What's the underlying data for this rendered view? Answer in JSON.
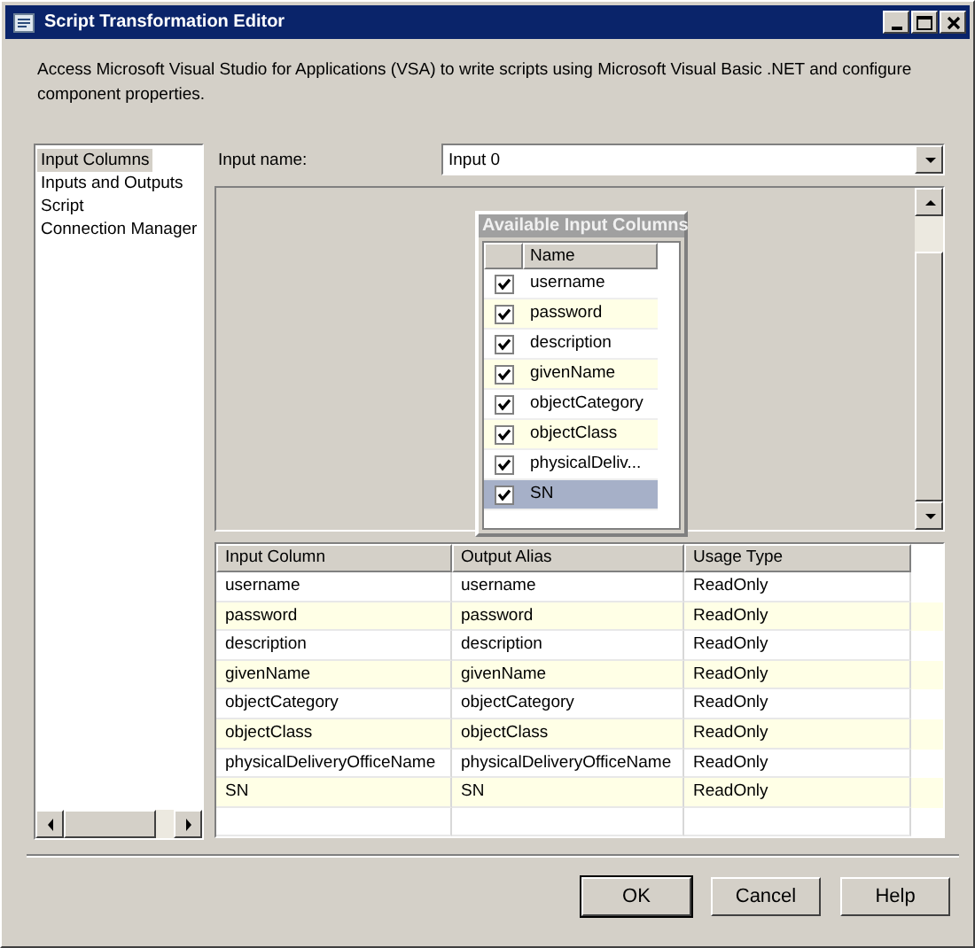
{
  "window": {
    "title": "Script Transformation Editor"
  },
  "description": "Access Microsoft Visual Studio for Applications (VSA) to write scripts using Microsoft Visual Basic .NET and configure component properties.",
  "sidebar": {
    "items": [
      {
        "label": "Input Columns",
        "selected": true
      },
      {
        "label": "Inputs and Outputs",
        "selected": false
      },
      {
        "label": "Script",
        "selected": false
      },
      {
        "label": "Connection Manager",
        "selected": false
      }
    ]
  },
  "input_name": {
    "label": "Input name:",
    "value": "Input 0"
  },
  "available_columns": {
    "title": "Available Input Columns",
    "header": "Name",
    "rows": [
      {
        "name": "username",
        "checked": true,
        "selected": false
      },
      {
        "name": "password",
        "checked": true,
        "selected": false
      },
      {
        "name": "description",
        "checked": true,
        "selected": false
      },
      {
        "name": "givenName",
        "checked": true,
        "selected": false
      },
      {
        "name": "objectCategory",
        "checked": true,
        "selected": false
      },
      {
        "name": "objectClass",
        "checked": true,
        "selected": false
      },
      {
        "name": "physicalDeliv...",
        "checked": true,
        "selected": false
      },
      {
        "name": "SN",
        "checked": true,
        "selected": true
      }
    ]
  },
  "grid": {
    "columns": [
      "Input Column",
      "Output Alias",
      "Usage Type"
    ],
    "rows": [
      [
        "username",
        "username",
        "ReadOnly"
      ],
      [
        "password",
        "password",
        "ReadOnly"
      ],
      [
        "description",
        "description",
        "ReadOnly"
      ],
      [
        "givenName",
        "givenName",
        "ReadOnly"
      ],
      [
        "objectCategory",
        "objectCategory",
        "ReadOnly"
      ],
      [
        "objectClass",
        "objectClass",
        "ReadOnly"
      ],
      [
        "physicalDeliveryOfficeName",
        "physicalDeliveryOfficeName",
        "ReadOnly"
      ],
      [
        "SN",
        "SN",
        "ReadOnly"
      ]
    ]
  },
  "buttons": [
    {
      "label": "OK",
      "default": true
    },
    {
      "label": "Cancel",
      "default": false
    },
    {
      "label": "Help",
      "default": false
    }
  ]
}
